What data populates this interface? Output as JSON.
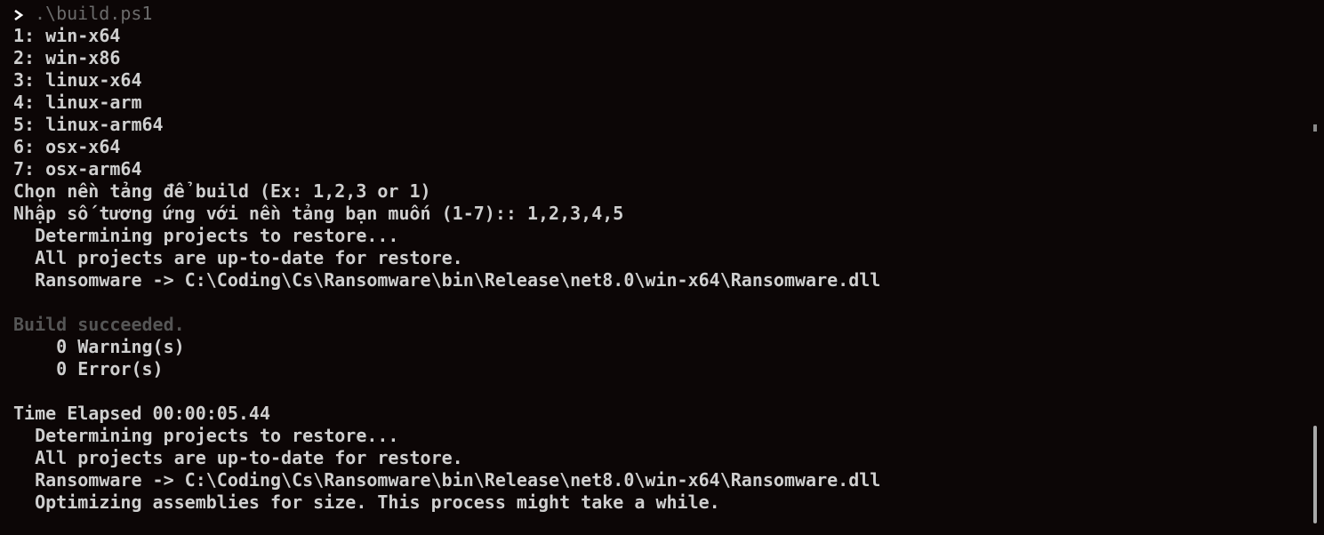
{
  "prompt": {
    "icon": "chevron-right-icon",
    "command": ".\\build.ps1"
  },
  "platforms": [
    "1: win-x64",
    "2: win-x86",
    "3: linux-x64",
    "4: linux-arm",
    "5: linux-arm64",
    "6: osx-x64",
    "7: osx-arm64"
  ],
  "choose_text": "Chọn nền tảng để build (Ex: 1,2,3 or 1)",
  "input_text": "Nhập số tương ứng với nền tảng bạn muốn (1-7):: 1,2,3,4,5",
  "build1": {
    "restore": "  Determining projects to restore...",
    "uptodate": "  All projects are up-to-date for restore.",
    "output": "  Ransomware -> C:\\Coding\\Cs\\Ransomware\\bin\\Release\\net8.0\\win-x64\\Ransomware.dll"
  },
  "result": {
    "succeeded": "Build succeeded.",
    "warnings": "    0 Warning(s)",
    "errors": "    0 Error(s)"
  },
  "elapsed": "Time Elapsed 00:00:05.44",
  "build2": {
    "restore": "  Determining projects to restore...",
    "uptodate": "  All projects are up-to-date for restore.",
    "output": "  Ransomware -> C:\\Coding\\Cs\\Ransomware\\bin\\Release\\net8.0\\win-x64\\Ransomware.dll",
    "optimizing": "  Optimizing assemblies for size. This process might take a while."
  }
}
